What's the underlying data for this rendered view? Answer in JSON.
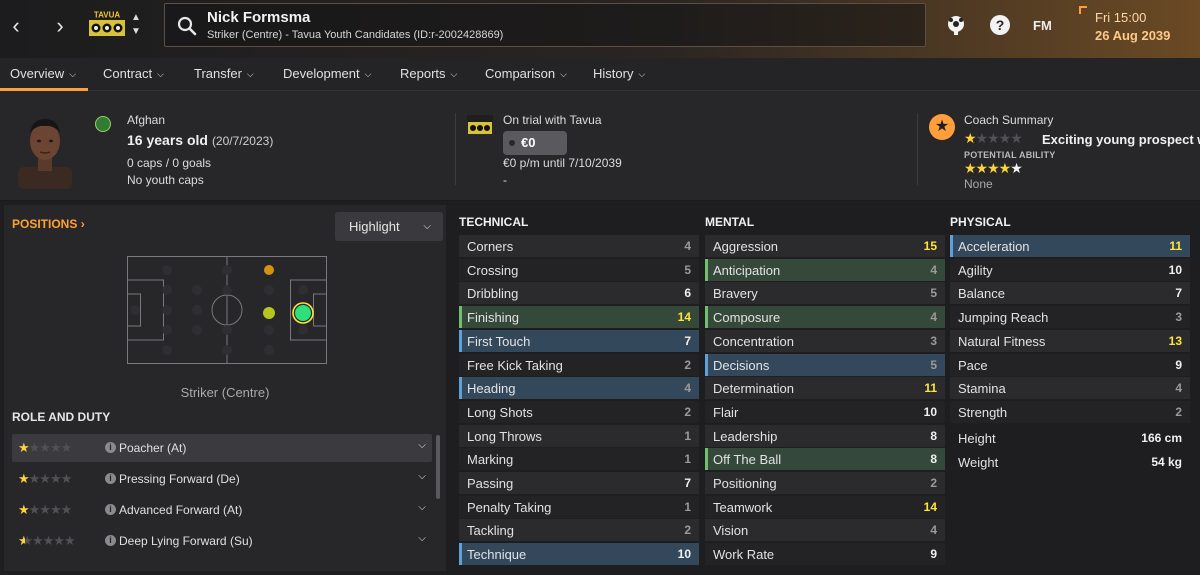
{
  "topbar": {
    "player_name": "Nick Formsma",
    "player_subtitle": "Striker (Centre) - Tavua Youth Candidates (ID:r-2002428869)",
    "club_crest_text": "TAVUA",
    "fm_label": "FM",
    "date_time": "Fri 15:00",
    "date_day": "26 Aug 2039"
  },
  "tabs": [
    {
      "label": "Overview"
    },
    {
      "label": "Contract"
    },
    {
      "label": "Transfer"
    },
    {
      "label": "Development"
    },
    {
      "label": "Reports"
    },
    {
      "label": "Comparison"
    },
    {
      "label": "History"
    }
  ],
  "header": {
    "nationality": "Afghan",
    "age": "16 years old",
    "dob": "(20/7/2023)",
    "caps": "0 caps / 0 goals",
    "youth_caps": "No youth caps",
    "trial": "On trial with Tavua",
    "value": "€0",
    "wage": "€0 p/m until 7/10/2039",
    "dash": "-",
    "coach_summary_title": "Coach Summary",
    "coach_summary_text": "Exciting young prospect w",
    "current_ability_stars": 1,
    "potential_label": "POTENTIAL ABILITY",
    "potential_ability_stars": 4.5,
    "potential_none": "None"
  },
  "positions": {
    "title": "POSITIONS",
    "highlight_label": "Highlight",
    "caption": "Striker (Centre)",
    "colors": {
      "natural": "#2ee07a",
      "competent": "#b5c61f",
      "unconvincing": "#d4930f"
    }
  },
  "roles": {
    "title": "ROLE AND DUTY",
    "items": [
      {
        "name": "Poacher (At)",
        "stars": 1
      },
      {
        "name": "Pressing Forward (De)",
        "stars": 1
      },
      {
        "name": "Advanced Forward (At)",
        "stars": 1
      },
      {
        "name": "Deep Lying Forward (Su)",
        "stars": 0.5
      }
    ]
  },
  "technical": {
    "title": "TECHNICAL",
    "attrs": [
      {
        "name": "Corners",
        "value": 4,
        "hl": ""
      },
      {
        "name": "Crossing",
        "value": 5,
        "hl": ""
      },
      {
        "name": "Dribbling",
        "value": 6,
        "hl": ""
      },
      {
        "name": "Finishing",
        "value": 14,
        "hl": "green"
      },
      {
        "name": "First Touch",
        "value": 7,
        "hl": "blue"
      },
      {
        "name": "Free Kick Taking",
        "value": 2,
        "hl": ""
      },
      {
        "name": "Heading",
        "value": 4,
        "hl": "blue"
      },
      {
        "name": "Long Shots",
        "value": 2,
        "hl": ""
      },
      {
        "name": "Long Throws",
        "value": 1,
        "hl": ""
      },
      {
        "name": "Marking",
        "value": 1,
        "hl": ""
      },
      {
        "name": "Passing",
        "value": 7,
        "hl": ""
      },
      {
        "name": "Penalty Taking",
        "value": 1,
        "hl": ""
      },
      {
        "name": "Tackling",
        "value": 2,
        "hl": ""
      },
      {
        "name": "Technique",
        "value": 10,
        "hl": "blue"
      }
    ]
  },
  "mental": {
    "title": "MENTAL",
    "attrs": [
      {
        "name": "Aggression",
        "value": 15,
        "hl": ""
      },
      {
        "name": "Anticipation",
        "value": 4,
        "hl": "green"
      },
      {
        "name": "Bravery",
        "value": 5,
        "hl": ""
      },
      {
        "name": "Composure",
        "value": 4,
        "hl": "green"
      },
      {
        "name": "Concentration",
        "value": 3,
        "hl": ""
      },
      {
        "name": "Decisions",
        "value": 5,
        "hl": "blue"
      },
      {
        "name": "Determination",
        "value": 11,
        "hl": ""
      },
      {
        "name": "Flair",
        "value": 10,
        "hl": ""
      },
      {
        "name": "Leadership",
        "value": 8,
        "hl": ""
      },
      {
        "name": "Off The Ball",
        "value": 8,
        "hl": "green"
      },
      {
        "name": "Positioning",
        "value": 2,
        "hl": ""
      },
      {
        "name": "Teamwork",
        "value": 14,
        "hl": ""
      },
      {
        "name": "Vision",
        "value": 4,
        "hl": ""
      },
      {
        "name": "Work Rate",
        "value": 9,
        "hl": ""
      }
    ]
  },
  "physical": {
    "title": "PHYSICAL",
    "attrs": [
      {
        "name": "Acceleration",
        "value": 11,
        "hl": "blue"
      },
      {
        "name": "Agility",
        "value": 10,
        "hl": ""
      },
      {
        "name": "Balance",
        "value": 7,
        "hl": ""
      },
      {
        "name": "Jumping Reach",
        "value": 3,
        "hl": ""
      },
      {
        "name": "Natural Fitness",
        "value": 13,
        "hl": ""
      },
      {
        "name": "Pace",
        "value": 9,
        "hl": ""
      },
      {
        "name": "Stamina",
        "value": 4,
        "hl": ""
      },
      {
        "name": "Strength",
        "value": 2,
        "hl": ""
      }
    ],
    "bio": [
      {
        "name": "Height",
        "value": "166 cm"
      },
      {
        "name": "Weight",
        "value": "54 kg"
      }
    ]
  }
}
